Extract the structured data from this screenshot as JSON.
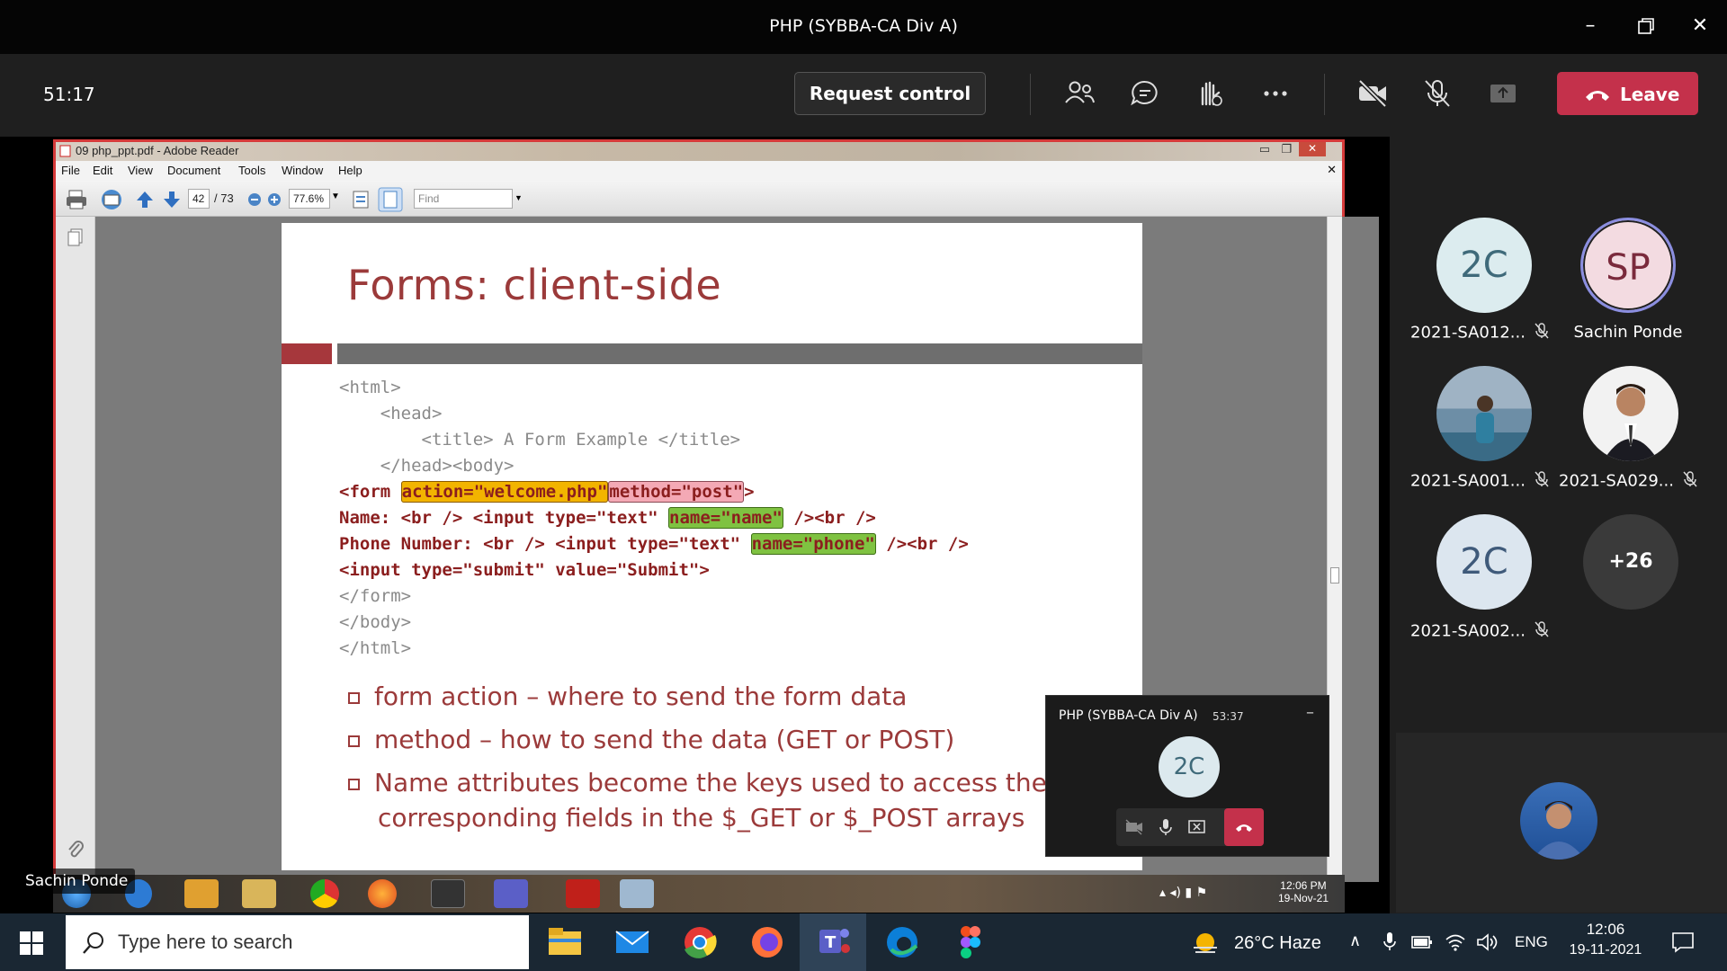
{
  "teams": {
    "window_title": "PHP (SYBBA-CA Div A)",
    "timer": "51:17",
    "request_control": "Request control",
    "leave": "Leave"
  },
  "reader": {
    "window_title": "09 php_ppt.pdf - Adobe Reader",
    "menu": [
      "File",
      "Edit",
      "View",
      "Document",
      "Tools",
      "Window",
      "Help"
    ],
    "page_current": "42",
    "page_total": "/ 73",
    "zoom": "77.6%",
    "find_placeholder": "Find"
  },
  "slide": {
    "title": "Forms: client-side",
    "code": {
      "l1": "<html>",
      "l2": "    <head>",
      "l3": "        <title> A Form Example </title>",
      "l4": "    </head><body>",
      "l5_pre": "<form ",
      "l5_action": "action=\"welcome.php\"",
      "l5_method": "method=\"post\"",
      "l5_post": ">",
      "l6_pre": "Name: <br /> <input type=\"text\" ",
      "l6_name": "name=\"name\"",
      "l6_post": " /><br />",
      "l7_pre": "Phone Number: <br /> <input type=\"text\" ",
      "l7_name": "name=\"phone\"",
      "l7_post": " /><br />",
      "l8": "<input type=\"submit\" value=\"Submit\">",
      "l9": "</form>",
      "l10": "</body>",
      "l11": "</html>"
    },
    "bullets": [
      "form action – where to send the form data",
      "method – how to send the data (GET or POST)",
      "Name attributes become the keys used to access the",
      "corresponding fields in the $_GET or $_POST arrays"
    ]
  },
  "shared_taskbar": {
    "time": "12:06 PM",
    "date": "19-Nov-21"
  },
  "presenter_label": "Sachin Ponde",
  "mini_window": {
    "title": "PHP (SYBBA-CA Div A)",
    "time": "53:37",
    "avatar": "2C"
  },
  "participants": [
    {
      "initials": "2C",
      "name": "2021-SA012...",
      "muted": true,
      "bg": "#dcecef",
      "fg": "#3f6a7a"
    },
    {
      "initials": "SP",
      "name": "Sachin Ponde",
      "muted": false,
      "bg": "#f3dbe1",
      "fg": "#7a2a3c"
    },
    {
      "initials": "",
      "name": "2021-SA001...",
      "muted": true,
      "photo": true
    },
    {
      "initials": "",
      "name": "2021-SA029...",
      "muted": true,
      "photo": true
    },
    {
      "initials": "2C",
      "name": "2021-SA002...",
      "muted": true,
      "bg": "#dce6ef",
      "fg": "#3f5a7a"
    },
    {
      "initials": "+26",
      "name": "",
      "muted": false,
      "bg": "#3a3a3a",
      "fg": "#ffffff"
    }
  ],
  "windows_taskbar": {
    "search_placeholder": "Type here to search",
    "weather": "26°C  Haze",
    "lang": "ENG",
    "time": "12:06",
    "date": "19-11-2021"
  },
  "colors": {
    "leave": "#c4314b",
    "slide_title": "#9b3a3a",
    "code_red": "#8b1e1e"
  }
}
